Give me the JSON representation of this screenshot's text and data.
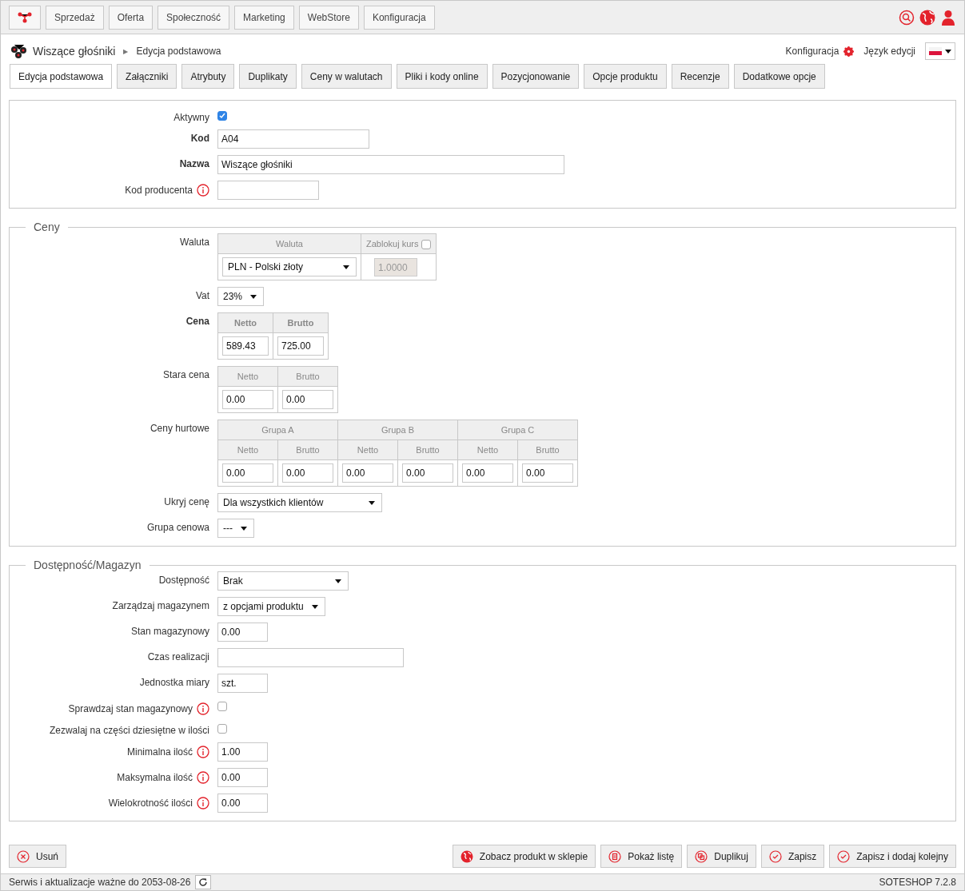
{
  "top_nav": {
    "items": [
      "Sprzedaż",
      "Oferta",
      "Społeczność",
      "Marketing",
      "WebStore",
      "Konfiguracja"
    ]
  },
  "header": {
    "title": "Wiszące głośniki",
    "separator": "▶",
    "breadcrumb": "Edycja podstawowa",
    "config_link": "Konfiguracja",
    "language_label": "Język edycji"
  },
  "tabs": [
    {
      "label": "Edycja podstawowa",
      "selected": true
    },
    {
      "label": "Załączniki",
      "selected": false
    },
    {
      "label": "Atrybuty",
      "selected": false
    },
    {
      "label": "Duplikaty",
      "selected": false
    },
    {
      "label": "Ceny w walutach",
      "selected": false
    },
    {
      "label": "Pliki i kody online",
      "selected": false
    },
    {
      "label": "Pozycjonowanie",
      "selected": false
    },
    {
      "label": "Opcje produktu",
      "selected": false
    },
    {
      "label": "Recenzje",
      "selected": false
    },
    {
      "label": "Dodatkowe opcje",
      "selected": false
    }
  ],
  "sections": [
    {
      "rows": [
        {
          "kind": "checkbox",
          "label": "Aktywny",
          "checked": true
        },
        {
          "kind": "text",
          "label": "Kod",
          "strong": true,
          "value": "A04"
        },
        {
          "kind": "text",
          "label": "Nazwa",
          "strong": true,
          "value": "Wiszące głośniki"
        },
        {
          "kind": "text",
          "label": "Kod producenta",
          "info": true
        }
      ]
    },
    {
      "title": "Ceny",
      "rows": [
        {
          "kind": "currency",
          "label": "Waluta",
          "headers": [
            "Waluta",
            "Zablokuj kurs"
          ],
          "lock_checked": false,
          "value": "PLN - Polski złoty",
          "rate": "1.0000"
        },
        {
          "kind": "select",
          "label": "Vat",
          "value": "23%"
        },
        {
          "kind": "price",
          "label": "Cena",
          "strong": true,
          "headers": [
            "Netto",
            "Brutto"
          ],
          "values": [
            "589.43",
            "725.00"
          ]
        },
        {
          "kind": "price",
          "label": "Stara cena",
          "headers": [
            "Netto",
            "Brutto"
          ],
          "values": [
            "0.00",
            "0.00"
          ]
        },
        {
          "kind": "wholesale",
          "label": "Ceny hurtowe",
          "groups": [
            {
              "name": "Grupa A",
              "headers": [
                "Netto",
                "Brutto"
              ],
              "values": [
                "0.00",
                "0.00"
              ]
            },
            {
              "name": "Grupa B",
              "headers": [
                "Netto",
                "Brutto"
              ],
              "values": [
                "0.00",
                "0.00"
              ]
            },
            {
              "name": "Grupa C",
              "headers": [
                "Netto",
                "Brutto"
              ],
              "values": [
                "0.00",
                "0.00"
              ]
            }
          ]
        },
        {
          "kind": "select",
          "label": "Ukryj cenę",
          "value": "Dla wszystkich klientów"
        },
        {
          "kind": "select",
          "label": "Grupa cenowa",
          "value": "---"
        }
      ]
    },
    {
      "title": "Dostępność/Magazyn",
      "rows": [
        {
          "kind": "select",
          "label": "Dostępność",
          "value": "Brak"
        },
        {
          "kind": "select",
          "label": "Zarządzaj magazynem",
          "value": "z opcjami produktu"
        },
        {
          "kind": "text",
          "label": "Stan magazynowy",
          "value": "0.00"
        },
        {
          "kind": "text",
          "label": "Czas realizacji"
        },
        {
          "kind": "text",
          "label": "Jednostka miary",
          "value": "szt."
        },
        {
          "kind": "checkbox",
          "label": "Sprawdzaj stan magazynowy",
          "info": true,
          "checked": false
        },
        {
          "kind": "checkbox",
          "label": "Zezwalaj na części dziesiętne w ilości",
          "checked": false
        },
        {
          "kind": "text",
          "label": "Minimalna ilość",
          "info": true,
          "value": "1.00"
        },
        {
          "kind": "text",
          "label": "Maksymalna ilość",
          "info": true,
          "value": "0.00"
        },
        {
          "kind": "text",
          "label": "Wielokrotność ilości",
          "info": true,
          "value": "0.00"
        }
      ]
    }
  ],
  "actions": {
    "left": [
      {
        "kind": "delete",
        "label": "Usuń"
      }
    ],
    "right": [
      {
        "kind": "globe",
        "label": "Zobacz produkt w sklepie"
      },
      {
        "kind": "list",
        "label": "Pokaż listę"
      },
      {
        "kind": "copy",
        "label": "Duplikuj"
      },
      {
        "kind": "check",
        "label": "Zapisz"
      },
      {
        "kind": "check",
        "label": "Zapisz i dodaj kolejny"
      }
    ]
  },
  "status_bar": {
    "text": "Serwis i aktualizacje ważne do 2053-08-26",
    "version": "SOTESHOP 7.2.8"
  }
}
